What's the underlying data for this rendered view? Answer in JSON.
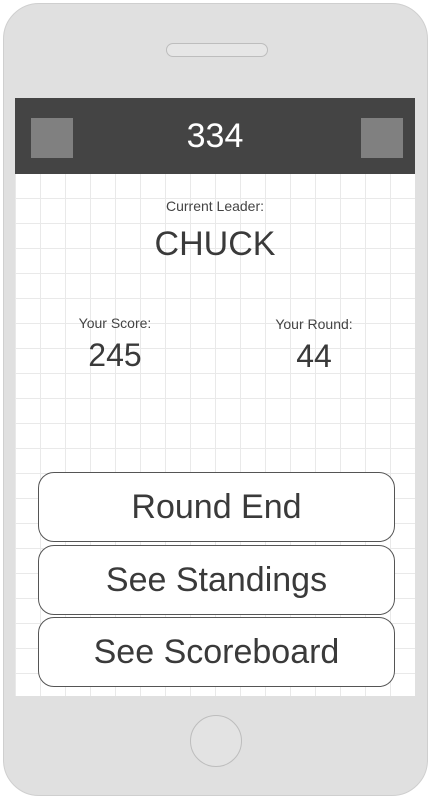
{
  "header": {
    "title": "334",
    "left_square_icon": "square-icon",
    "right_square_icon": "square-icon"
  },
  "leader": {
    "label": "Current Leader:",
    "name": "CHUCK"
  },
  "stats": {
    "score_label": "Your Score:",
    "score_value": "245",
    "round_label": "Your Round:",
    "round_value": "44"
  },
  "actions": {
    "round_end": "Round End",
    "see_standings": "See Standings",
    "see_scoreboard": "See Scoreboard"
  },
  "colors": {
    "header_bg": "#444444",
    "header_square": "#808080",
    "device_frame": "#e0e0e0"
  }
}
